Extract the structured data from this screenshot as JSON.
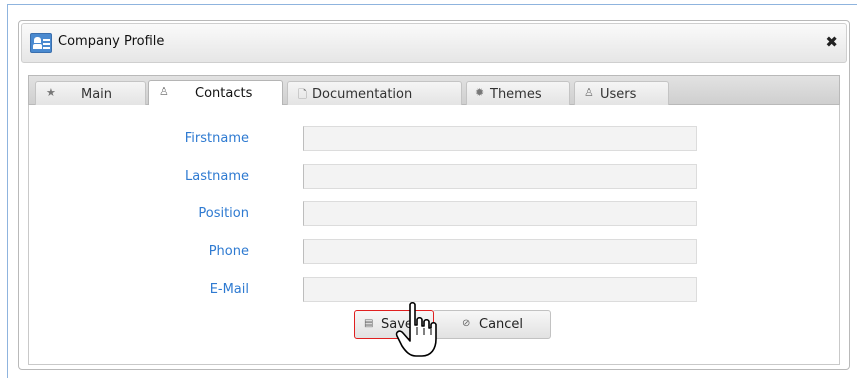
{
  "dialog": {
    "title": "Company Profile",
    "icon": "profile-card-icon",
    "close_glyph": "✖"
  },
  "tabs": [
    {
      "label": "Main",
      "icon": "star-icon",
      "glyph": "★",
      "active": false
    },
    {
      "label": "Contacts",
      "icon": "user-icon",
      "glyph": "♙",
      "active": true
    },
    {
      "label": "Documentation",
      "icon": "document-icon",
      "glyph": "🗋",
      "active": false
    },
    {
      "label": "Themes",
      "icon": "gear-icon",
      "glyph": "✹",
      "active": false
    },
    {
      "label": "Users",
      "icon": "users-icon",
      "glyph": "♙",
      "active": false
    }
  ],
  "form": {
    "fields": [
      {
        "label": "Firstname",
        "value": ""
      },
      {
        "label": "Lastname",
        "value": ""
      },
      {
        "label": "Position",
        "value": ""
      },
      {
        "label": "Phone",
        "value": ""
      },
      {
        "label": "E-Mail",
        "value": ""
      }
    ]
  },
  "buttons": {
    "save": {
      "label": "Save",
      "icon": "save-icon",
      "glyph": "▤"
    },
    "cancel": {
      "label": "Cancel",
      "icon": "cancel-icon",
      "glyph": "⊘"
    }
  },
  "colors": {
    "label_blue": "#2e7ad1",
    "save_highlight": "#e02020",
    "title_icon_blue": "#4a8ad0"
  }
}
